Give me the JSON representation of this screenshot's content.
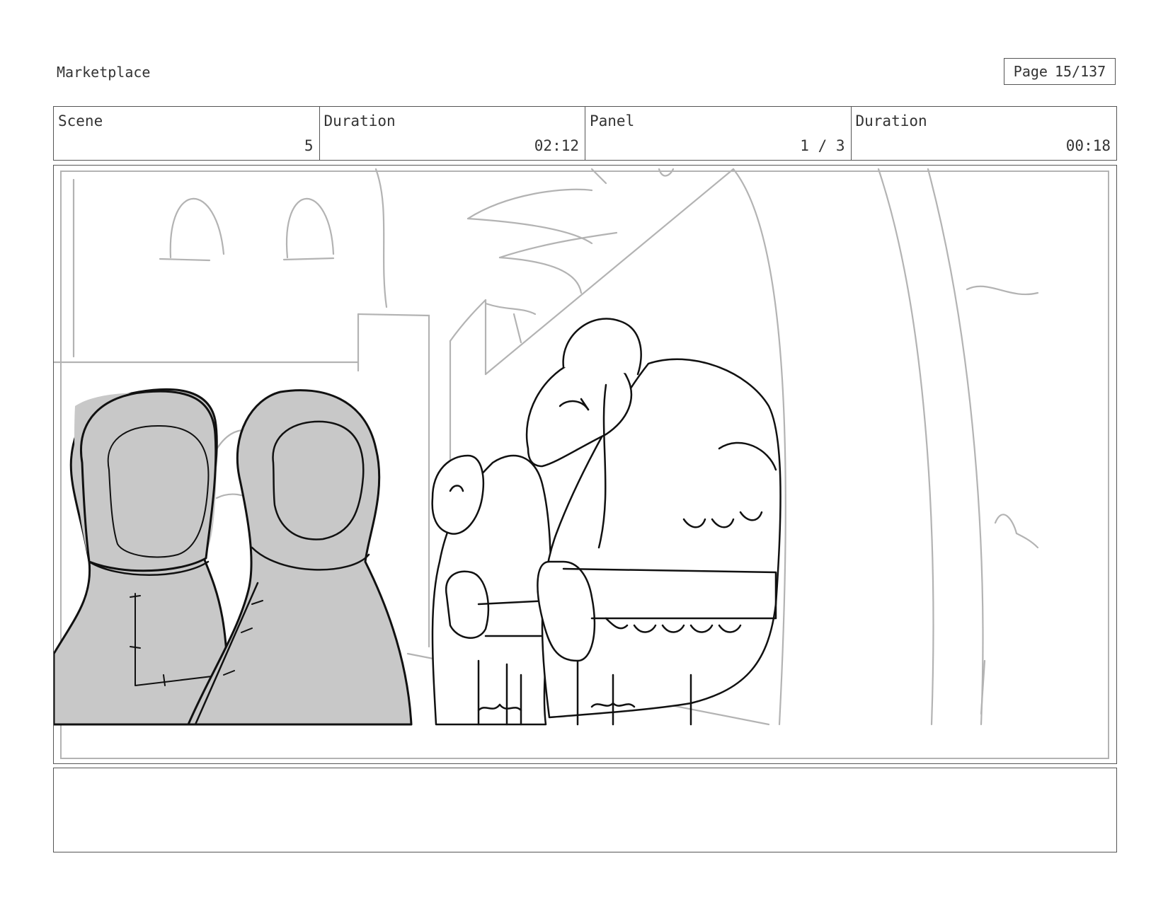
{
  "header": {
    "project_title": "Marketplace",
    "page_label": "Page",
    "page_value": "15/137"
  },
  "info": {
    "scene_label": "Scene",
    "scene_value": "5",
    "scene_duration_label": "Duration",
    "scene_duration_value": "02:12",
    "panel_label": "Panel",
    "panel_value": "1 / 3",
    "panel_duration_label": "Duration",
    "panel_duration_value": "00:18"
  },
  "notes": {
    "text": ""
  },
  "colors": {
    "frame_border": "#555555",
    "sketch_background": "#b3b3b3",
    "sketch_ink": "#111111",
    "hood_fill": "#c8c8c8"
  }
}
